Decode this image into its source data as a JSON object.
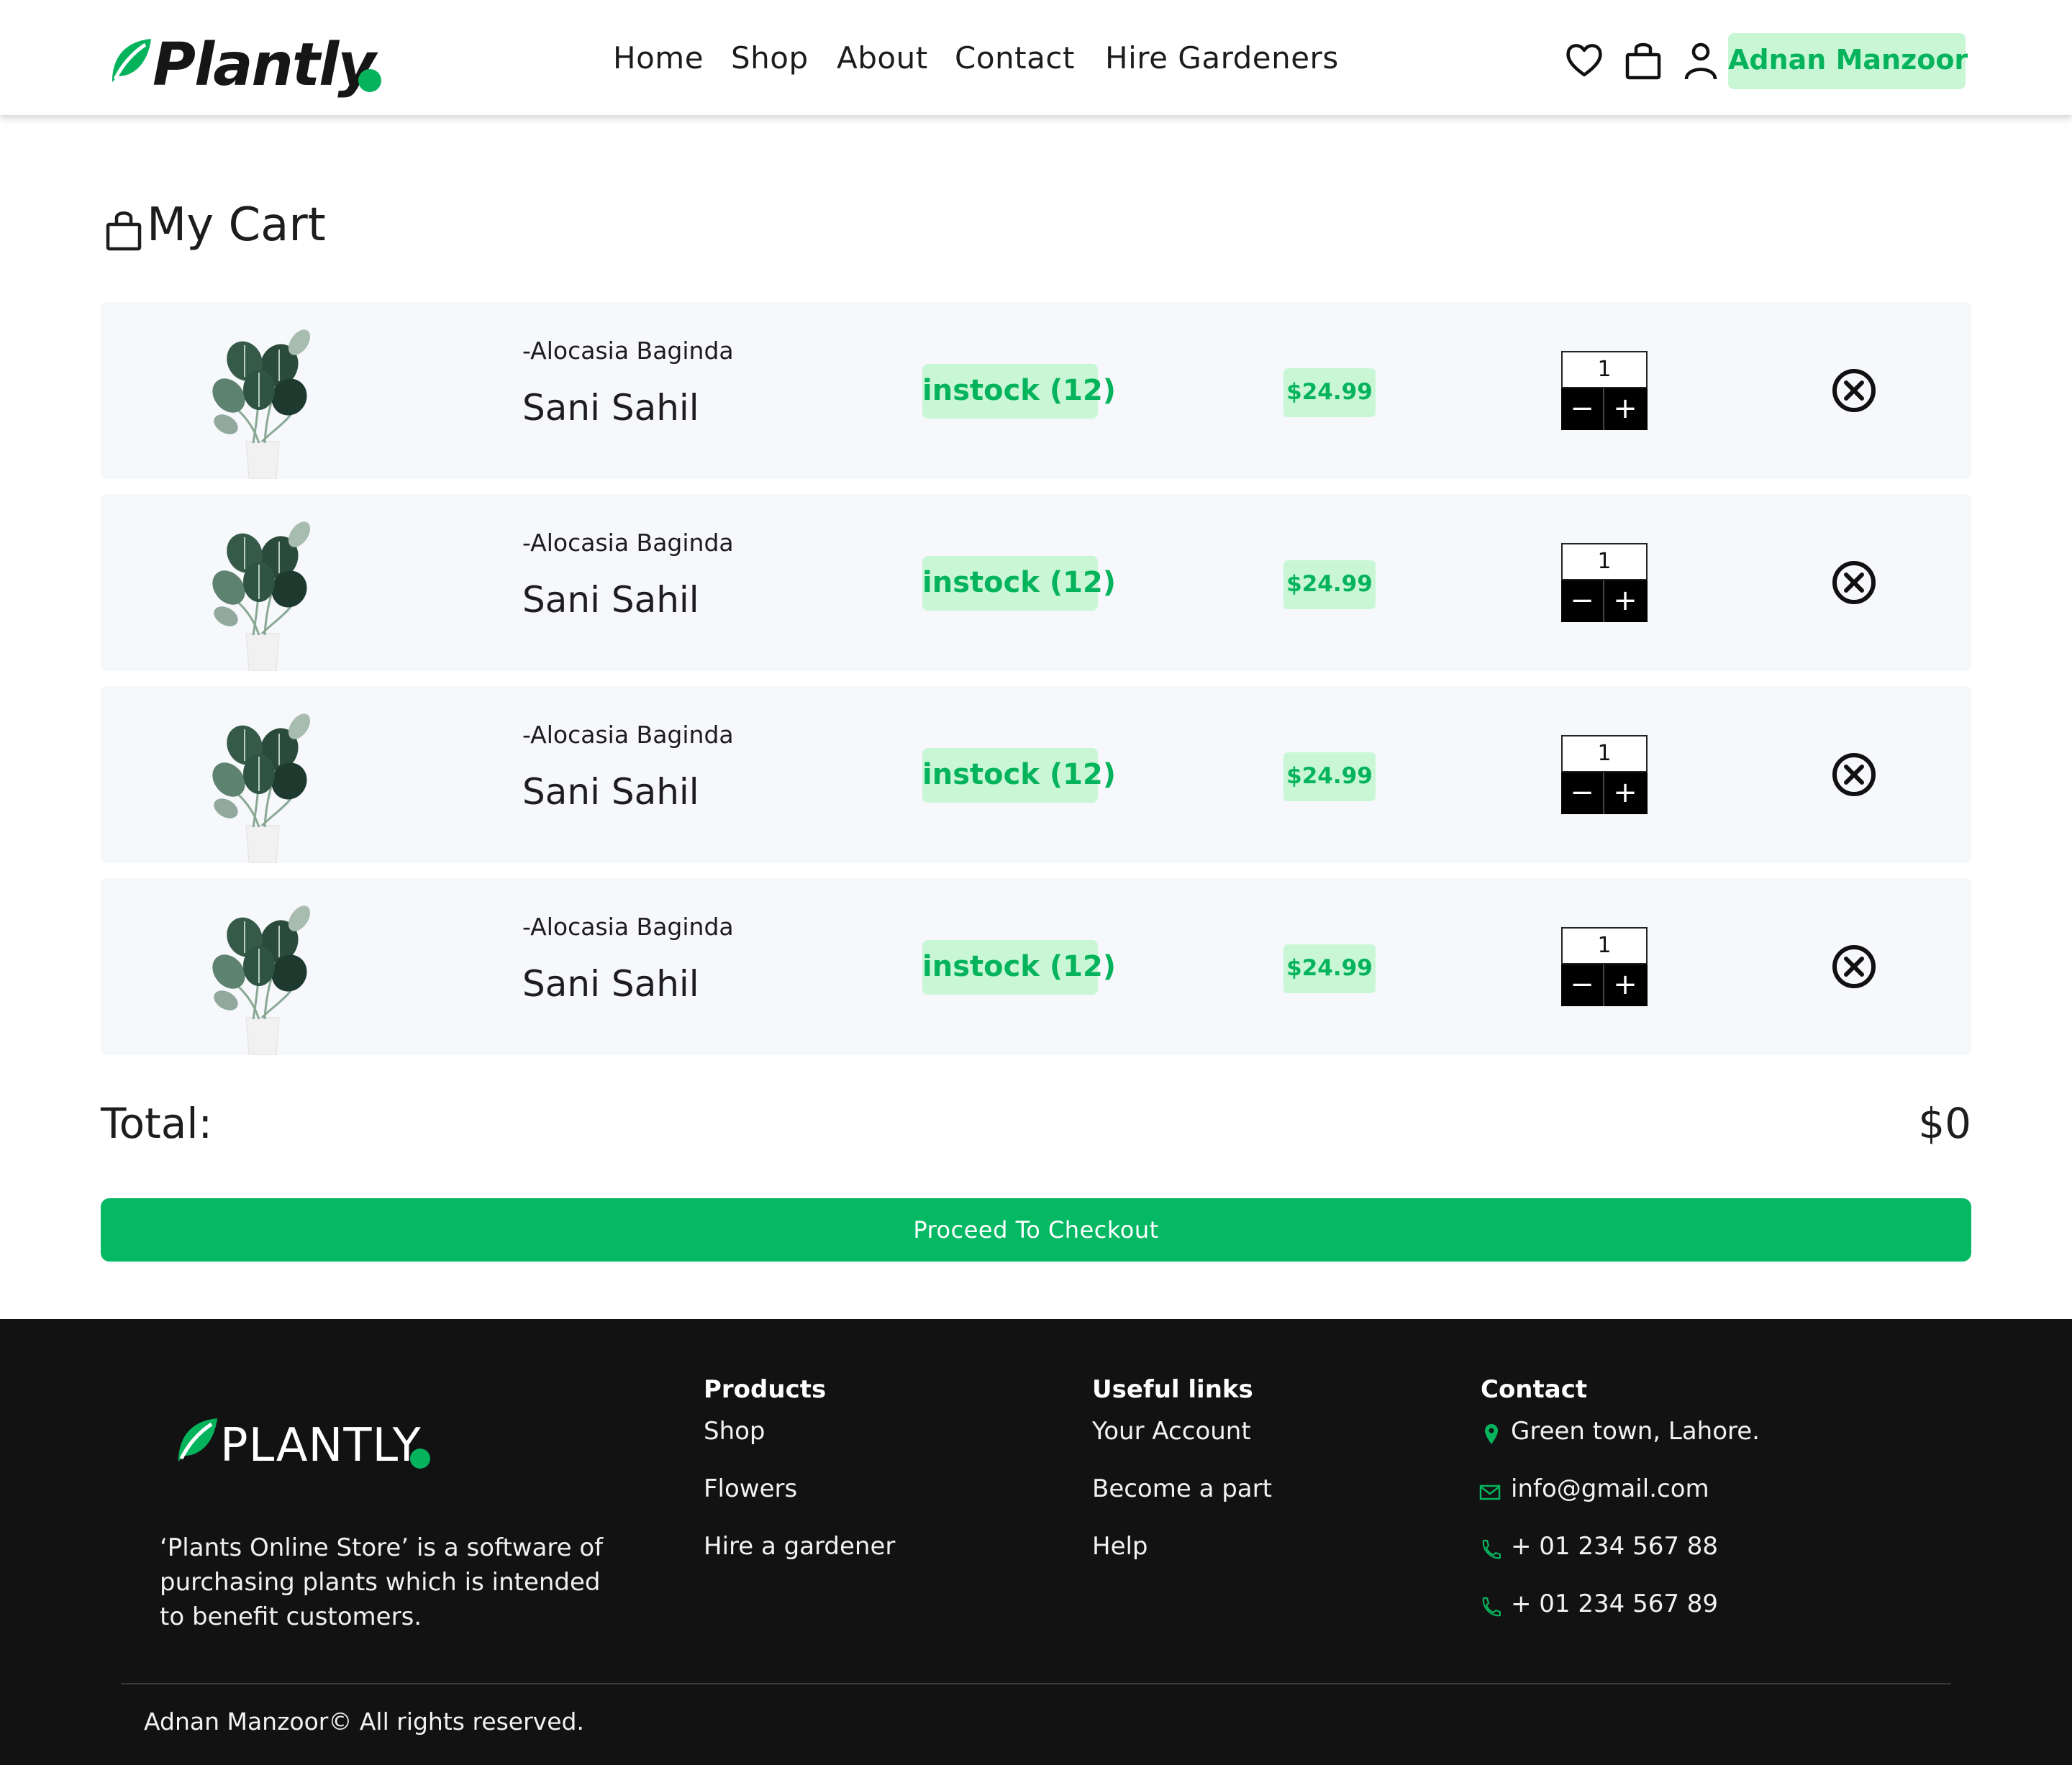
{
  "header": {
    "brand": "Plantly",
    "nav": [
      "Home",
      "Shop",
      "About",
      "Contact",
      "Hire Gardeners"
    ],
    "user_name": "Adnan Manzoor",
    "icons": [
      "heart-icon",
      "shopping-bag-icon",
      "user-icon"
    ]
  },
  "cart": {
    "title": "My Cart",
    "items": [
      {
        "subtitle": "-Alocasia Baginda",
        "name": "Sani Sahil",
        "stock": "instock (12)",
        "price": "$24.99",
        "qty": "1"
      },
      {
        "subtitle": "-Alocasia Baginda",
        "name": "Sani Sahil",
        "stock": "instock (12)",
        "price": "$24.99",
        "qty": "1"
      },
      {
        "subtitle": "-Alocasia Baginda",
        "name": "Sani Sahil",
        "stock": "instock (12)",
        "price": "$24.99",
        "qty": "1"
      },
      {
        "subtitle": "-Alocasia Baginda",
        "name": "Sani Sahil",
        "stock": "instock (12)",
        "price": "$24.99",
        "qty": "1"
      }
    ],
    "total_label": "Total:",
    "total_value": "$0",
    "checkout_label": "Proceed To Checkout",
    "stepper": {
      "minus": "−",
      "plus": "+"
    }
  },
  "footer": {
    "brand": "PLANTLY",
    "description": "‘Plants Online Store’ is a software of purchasing plants which is intended to benefit customers.",
    "products": {
      "heading": "Products",
      "links": [
        "Shop",
        "Flowers",
        "Hire a gardener"
      ]
    },
    "useful_links": {
      "heading": "Useful links",
      "links": [
        "Your Account",
        "Become a part",
        "Help"
      ]
    },
    "contact": {
      "heading": "Contact",
      "address": "Green town, Lahore.",
      "email": "info@gmail.com",
      "phone1": "+ 01 234 567 88",
      "phone2": "+ 01 234 567 89"
    },
    "copyright": "Adnan Manzoor© All rights reserved."
  },
  "colors": {
    "accent": "#05b35d",
    "accent_light": "#c9f7d6",
    "footer_bg": "#121212",
    "row_bg": "#f7f8fc"
  }
}
